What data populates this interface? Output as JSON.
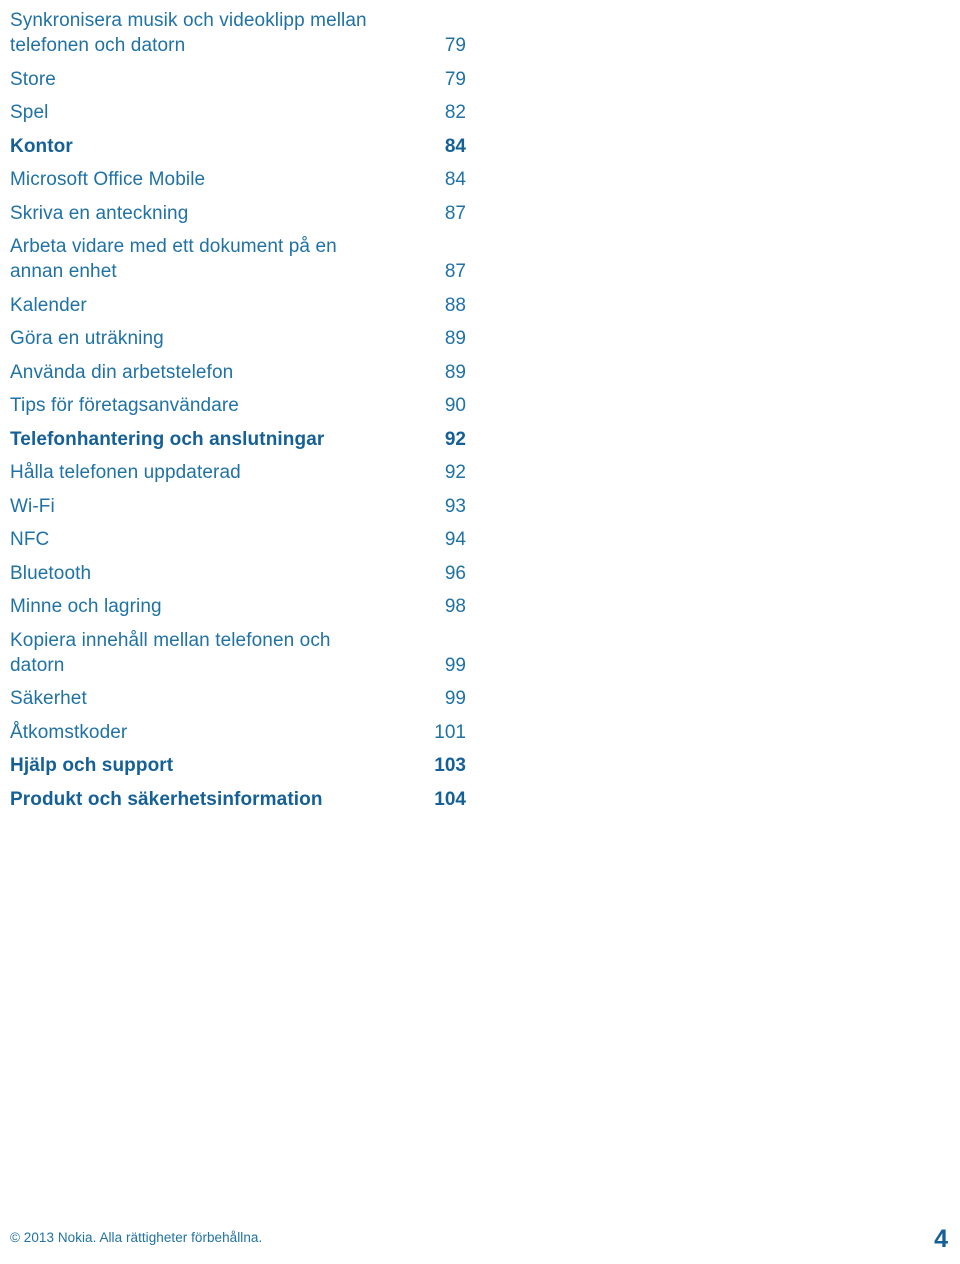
{
  "colors": {
    "text_regular": "#2072a5",
    "text_bold": "#156096",
    "background": "#ffffff"
  },
  "toc": {
    "entries": [
      {
        "title": "Synkronisera musik och videoklipp mellan telefonen och datorn",
        "page": "79",
        "bold": false,
        "multiline": true
      },
      {
        "title": "Store",
        "page": "79",
        "bold": false,
        "multiline": false
      },
      {
        "title": "Spel",
        "page": "82",
        "bold": false,
        "multiline": false
      },
      {
        "title": "Kontor",
        "page": "84",
        "bold": true,
        "multiline": false
      },
      {
        "title": "Microsoft Office Mobile",
        "page": "84",
        "bold": false,
        "multiline": false
      },
      {
        "title": "Skriva en anteckning",
        "page": "87",
        "bold": false,
        "multiline": false
      },
      {
        "title": "Arbeta vidare med ett dokument på en annan enhet",
        "page": "87",
        "bold": false,
        "multiline": true
      },
      {
        "title": "Kalender",
        "page": "88",
        "bold": false,
        "multiline": false
      },
      {
        "title": "Göra en uträkning",
        "page": "89",
        "bold": false,
        "multiline": false
      },
      {
        "title": "Använda din arbetstelefon",
        "page": "89",
        "bold": false,
        "multiline": false
      },
      {
        "title": "Tips för företagsanvändare",
        "page": "90",
        "bold": false,
        "multiline": false
      },
      {
        "title": "Telefonhantering och anslutningar",
        "page": "92",
        "bold": true,
        "multiline": false
      },
      {
        "title": "Hålla telefonen uppdaterad",
        "page": "92",
        "bold": false,
        "multiline": false
      },
      {
        "title": "Wi-Fi",
        "page": "93",
        "bold": false,
        "multiline": false
      },
      {
        "title": "NFC",
        "page": "94",
        "bold": false,
        "multiline": false
      },
      {
        "title": "Bluetooth",
        "page": "96",
        "bold": false,
        "multiline": false
      },
      {
        "title": "Minne och lagring",
        "page": "98",
        "bold": false,
        "multiline": false
      },
      {
        "title": "Kopiera innehåll mellan telefonen och datorn",
        "page": "99",
        "bold": false,
        "multiline": true
      },
      {
        "title": "Säkerhet",
        "page": "99",
        "bold": false,
        "multiline": false
      },
      {
        "title": "Åtkomstkoder",
        "page": "101",
        "bold": false,
        "multiline": false
      },
      {
        "title": "Hjälp och support",
        "page": "103",
        "bold": true,
        "multiline": false
      },
      {
        "title": "Produkt och säkerhetsinformation",
        "page": "104",
        "bold": true,
        "multiline": false
      }
    ]
  },
  "footer": {
    "copyright": "© 2013 Nokia. Alla rättigheter förbehållna.",
    "page_number": "4"
  }
}
